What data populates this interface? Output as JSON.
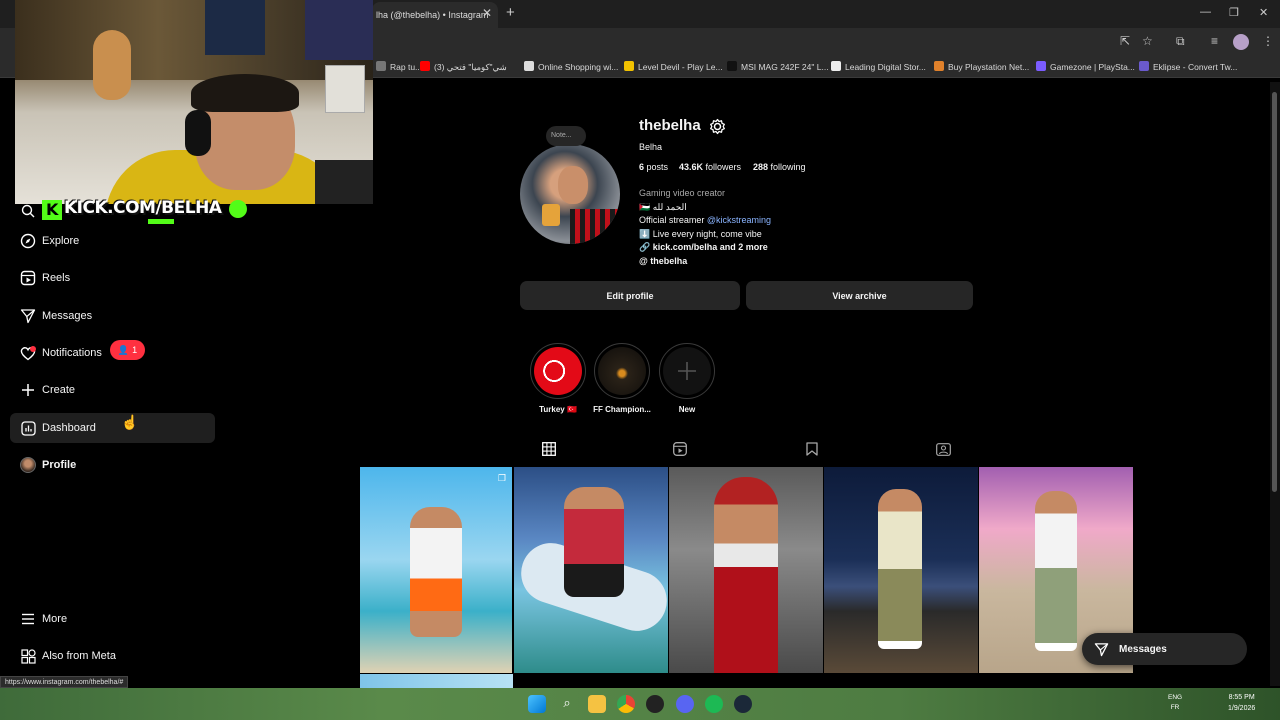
{
  "browser": {
    "tab_title": "lha (@thebelha) • Instagram",
    "close_tab": "✕",
    "new_tab": "+",
    "bookmarks": [
      {
        "label": "Rap tu...",
        "color": "#777777"
      },
      {
        "label": "شي\"كوميا\" فتحي (3)",
        "color": "#ff0000"
      },
      {
        "label": "Online Shopping wi...",
        "color": "#dddddd"
      },
      {
        "label": "Level Devil - Play Le...",
        "color": "#f2c200"
      },
      {
        "label": "MSI MAG 242F 24\" L...",
        "color": "#111111"
      },
      {
        "label": "Leading Digital Stor...",
        "color": "#eeeeee"
      },
      {
        "label": "Buy Playstation Net...",
        "color": "#e0812b"
      },
      {
        "label": "Gamezone | PlaySta...",
        "color": "#7b5cff"
      },
      {
        "label": "Eklipse - Convert Tw...",
        "color": "#6a5acd"
      }
    ],
    "status_url": "https://www.instagram.com/thebelha/#"
  },
  "stream_overlay": {
    "kick_text": "KICK.COM/BELHA"
  },
  "nav": {
    "explore": "Explore",
    "reels": "Reels",
    "messages": "Messages",
    "notifications": "Notifications",
    "notifications_count": "1",
    "create": "Create",
    "dashboard": "Dashboard",
    "profile": "Profile",
    "more": "More",
    "also_from_meta": "Also from Meta"
  },
  "profile": {
    "note": "Note...",
    "username": "thebelha",
    "display_name": "Belha",
    "posts_count": "6",
    "posts_label": "posts",
    "followers_count": "43.6K",
    "followers_label": "followers",
    "following_count": "288",
    "following_label": "following",
    "bio_category": "Gaming video creator",
    "bio_line1": "🇵🇸 الحمد لله",
    "bio_line2_prefix": "Official streamer ",
    "bio_line2_mention": "@kickstreaming",
    "bio_line3": "⬇️ Live every night, come vibe",
    "bio_link": "kick.com/belha and 2 more",
    "bio_threads": "thebelha",
    "edit_profile": "Edit profile",
    "view_archive": "View archive"
  },
  "highlights": [
    {
      "label": "Turkey 🇹🇷"
    },
    {
      "label": "FF Champion..."
    },
    {
      "label": "New"
    }
  ],
  "messages_pill": "Messages",
  "taskbar": {
    "lang_top": "ENG",
    "lang_bottom": "FR",
    "time": "8:55 PM",
    "date": "1/9/2026"
  }
}
